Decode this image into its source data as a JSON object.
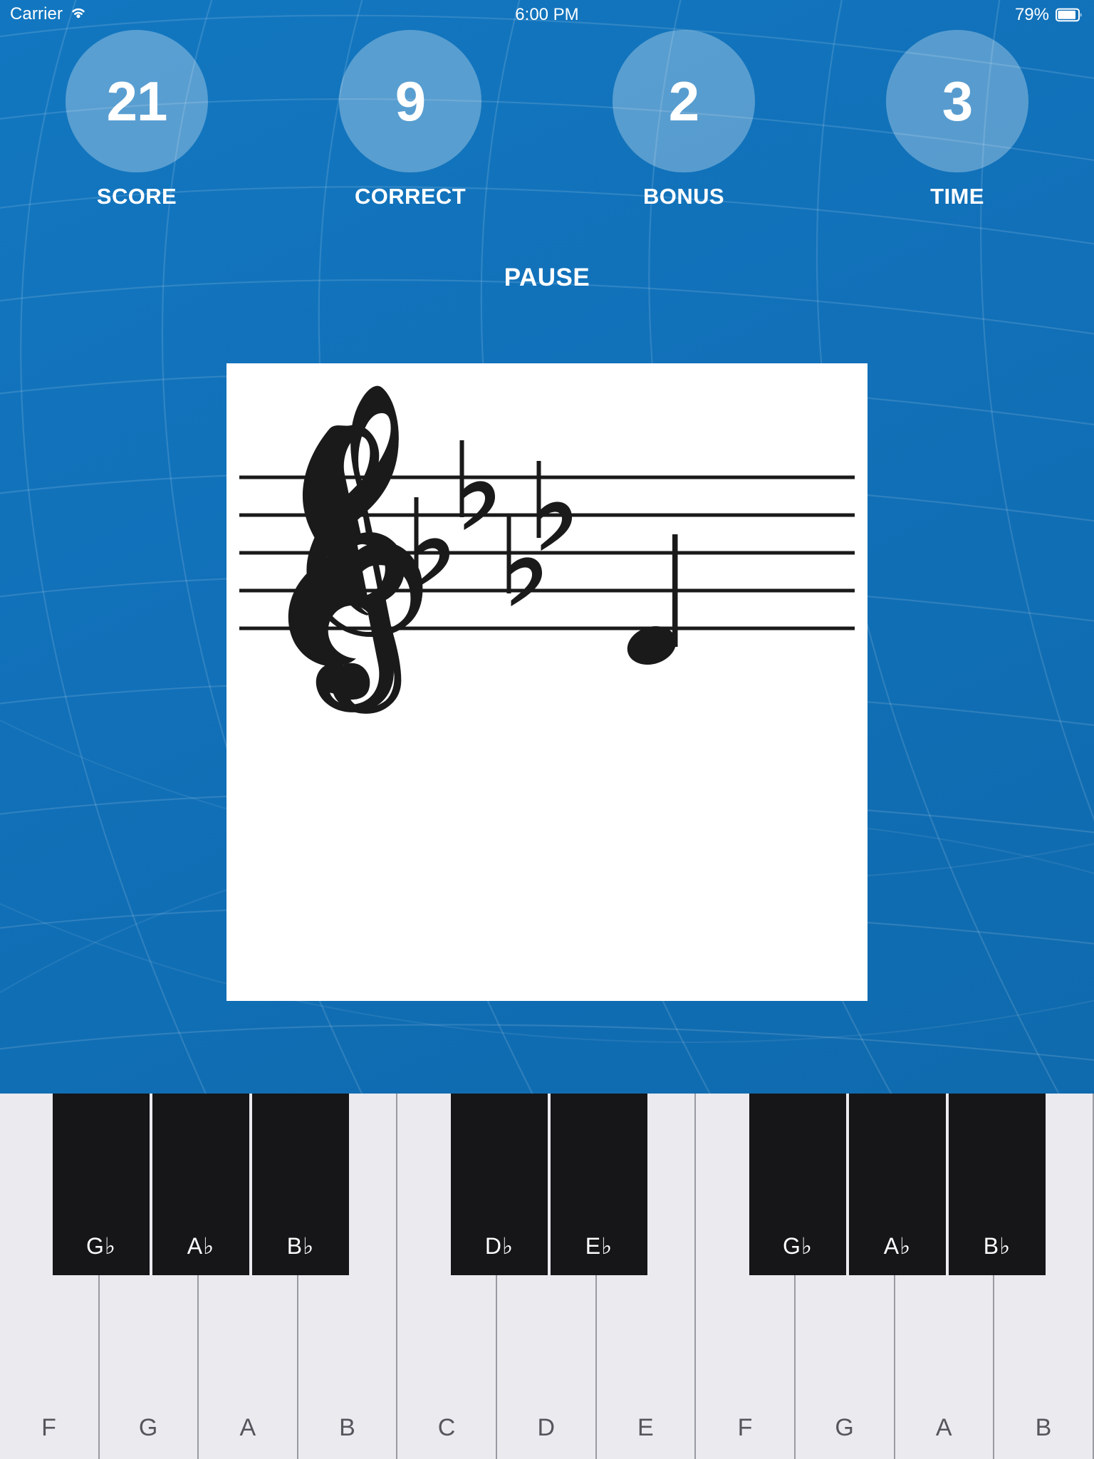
{
  "status_bar": {
    "carrier": "Carrier",
    "wifi_icon": "wifi-icon",
    "time": "6:00 PM",
    "battery_percent": "79%",
    "battery_icon": "battery-icon"
  },
  "theme": {
    "background_blue": "#1170b8",
    "bubble_fill": "rgba(255,255,255,0.30)",
    "card_white": "#ffffff",
    "white_key": "#eaeaef",
    "black_key": "#161619",
    "white_key_text": "#55555c",
    "mesh_line": "rgba(255,255,255,0.13)"
  },
  "stats": [
    {
      "value": "21",
      "label": "SCORE"
    },
    {
      "value": "9",
      "label": "CORRECT"
    },
    {
      "value": "2",
      "label": "BONUS"
    },
    {
      "value": "3",
      "label": "TIME"
    }
  ],
  "pause": {
    "label": "PAUSE"
  },
  "staff": {
    "clef": "treble-clef",
    "key_signature_accidental": "flat",
    "key_signature_count": 4,
    "key_signature_notes": [
      "B♭",
      "E♭",
      "A♭",
      "D♭"
    ],
    "note_count": 1,
    "note_duration": "quarter",
    "note_stem_direction": "up",
    "line_count": 5
  },
  "keyboard": {
    "white_keys": [
      {
        "label": "F"
      },
      {
        "label": "G"
      },
      {
        "label": "A"
      },
      {
        "label": "B"
      },
      {
        "label": "C"
      },
      {
        "label": "D"
      },
      {
        "label": "E"
      },
      {
        "label": "F"
      },
      {
        "label": "G"
      },
      {
        "label": "A"
      },
      {
        "label": "B"
      }
    ],
    "black_keys": [
      {
        "label": "G♭",
        "after_white_index": 0
      },
      {
        "label": "A♭",
        "after_white_index": 1
      },
      {
        "label": "B♭",
        "after_white_index": 2
      },
      {
        "label": "D♭",
        "after_white_index": 4
      },
      {
        "label": "E♭",
        "after_white_index": 5
      },
      {
        "label": "G♭",
        "after_white_index": 7
      },
      {
        "label": "A♭",
        "after_white_index": 8
      },
      {
        "label": "B♭",
        "after_white_index": 9
      }
    ]
  }
}
